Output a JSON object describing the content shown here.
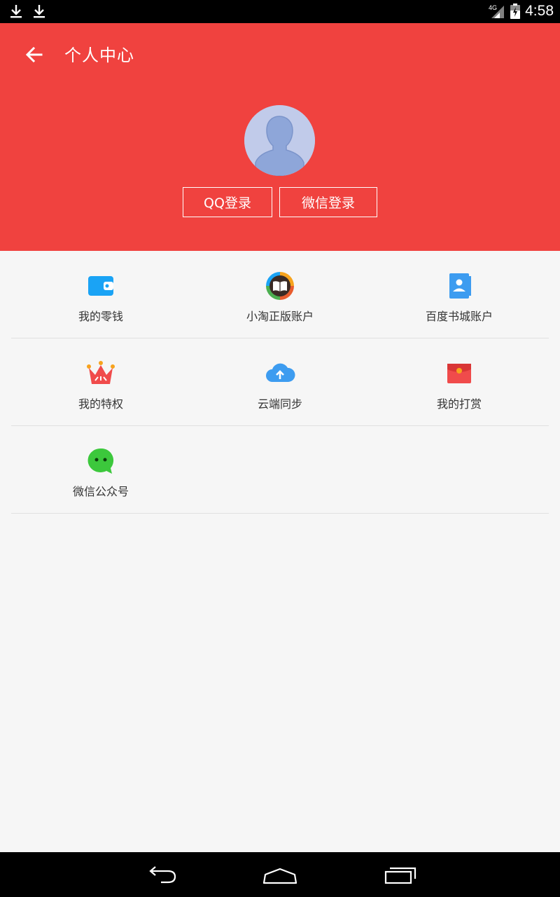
{
  "status_bar": {
    "time": "4:58",
    "network": "4G",
    "icons": [
      "download-icon",
      "download-icon",
      "signal-icon",
      "battery-icon"
    ]
  },
  "header": {
    "title": "个人中心",
    "back_icon": "arrow-left-icon",
    "background": "#f0423f",
    "avatar_icon": "default-avatar-icon",
    "buttons": {
      "qq_login": "QQ登录",
      "wechat_login": "微信登录"
    }
  },
  "menu": {
    "rows": [
      [
        {
          "label": "我的零钱",
          "icon": "wallet-icon",
          "color": "#1aa3f5"
        },
        {
          "label": "小淘正版账户",
          "icon": "book-ring-icon",
          "color": "#e85c2e"
        },
        {
          "label": "百度书城账户",
          "icon": "contact-book-icon",
          "color": "#3d9cf0"
        }
      ],
      [
        {
          "label": "我的特权",
          "icon": "crown-icon",
          "color": "#f04b4b"
        },
        {
          "label": "云端同步",
          "icon": "cloud-upload-icon",
          "color": "#3d9cf0"
        },
        {
          "label": "我的打赏",
          "icon": "red-envelope-icon",
          "color": "#f04b4b"
        }
      ],
      [
        {
          "label": "微信公众号",
          "icon": "wechat-icon",
          "color": "#3cc83c"
        }
      ]
    ]
  },
  "nav_bar": {
    "buttons": [
      "back-nav-icon",
      "home-nav-icon",
      "recents-nav-icon"
    ]
  }
}
